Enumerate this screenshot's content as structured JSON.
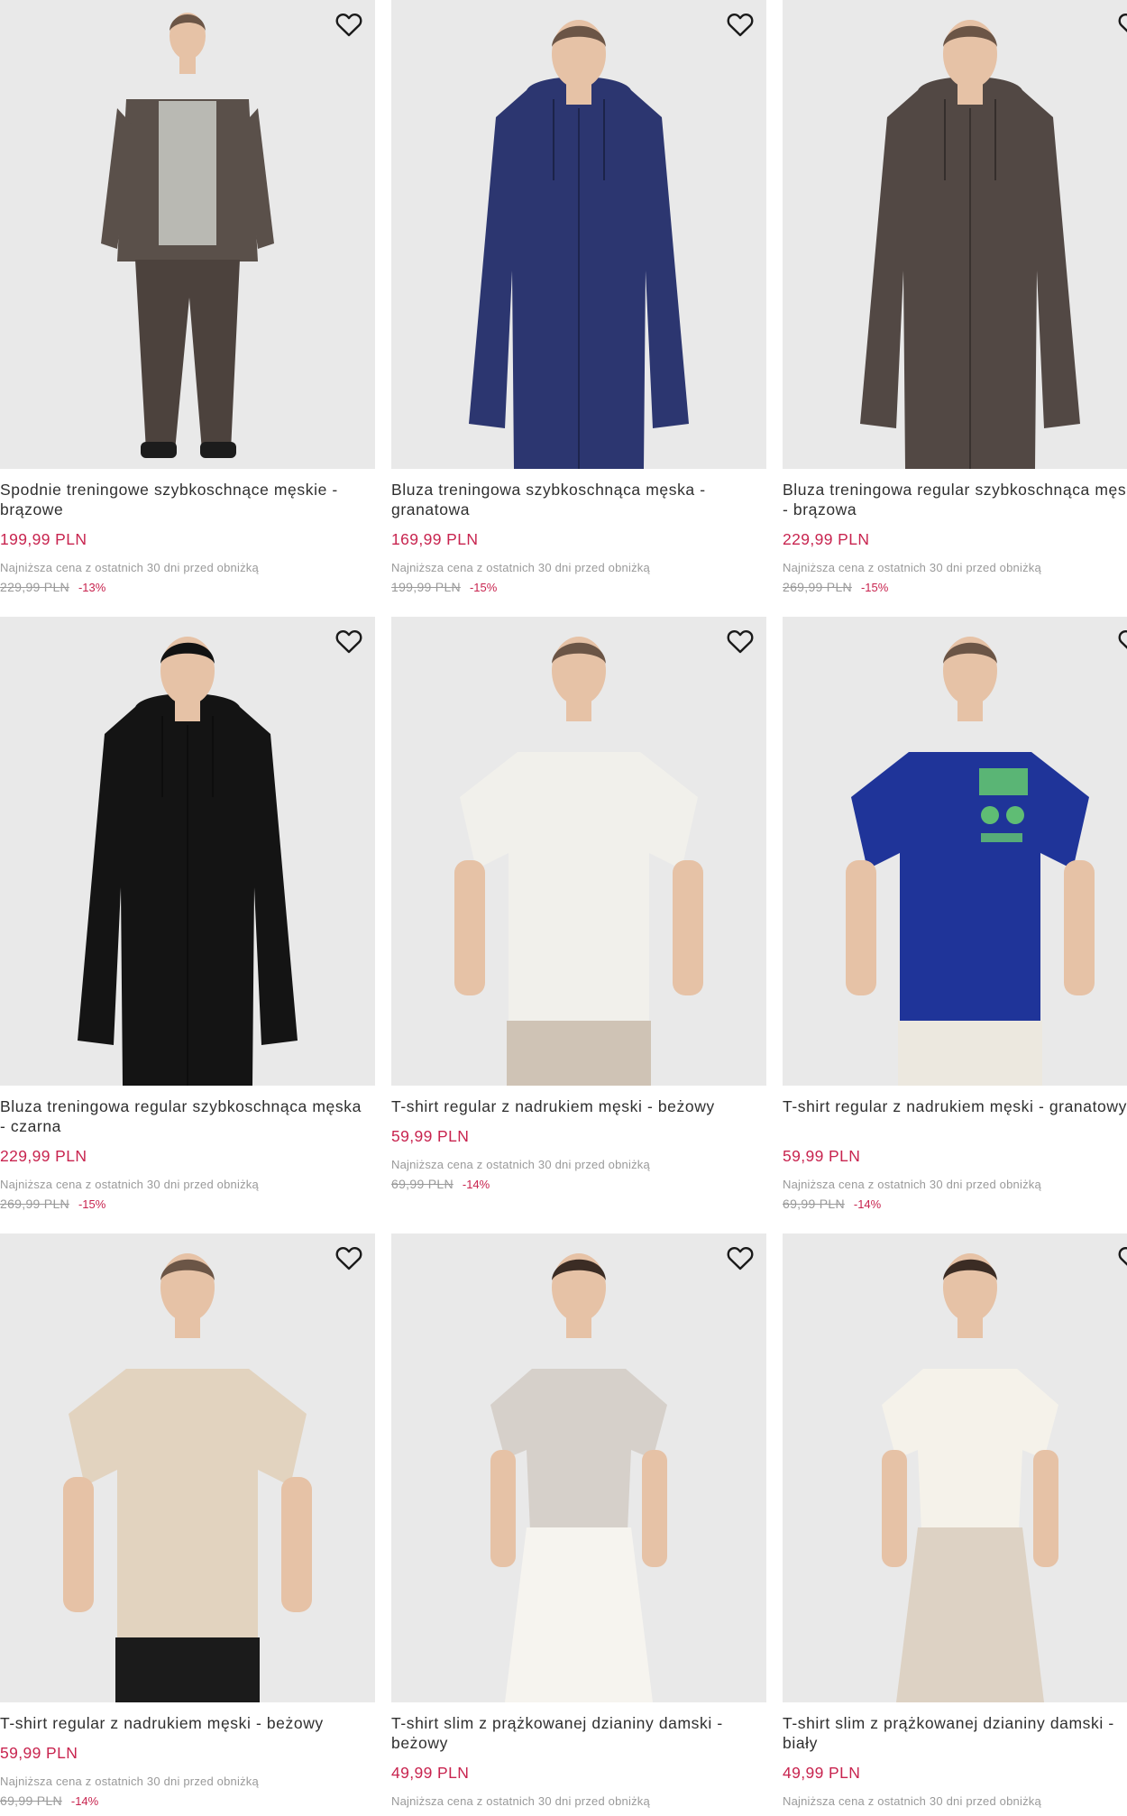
{
  "common": {
    "lowest_label": "Najniższa cena z ostatnich 30 dni przed obniżką"
  },
  "products": [
    {
      "name": "Spodnie treningowe szybkoschnące męskie - brązowe",
      "price": "199,99 PLN",
      "old_price": "229,99 PLN",
      "discount": "-13%",
      "garment": "jacket-tracksuit",
      "colors": {
        "top": "#5a504a",
        "inner": "#b9b9b3",
        "bottom": "#4c423d"
      }
    },
    {
      "name": "Bluza treningowa szybkoschnąca męska - granatowa",
      "price": "169,99 PLN",
      "old_price": "199,99 PLN",
      "discount": "-15%",
      "garment": "hoodie",
      "colors": {
        "top": "#2c3670",
        "bottom": "#2c3670"
      }
    },
    {
      "name": "Bluza treningowa regular szybkoschnąca męska - brązowa",
      "price": "229,99 PLN",
      "old_price": "269,99 PLN",
      "discount": "-15%",
      "garment": "hoodie",
      "colors": {
        "top": "#524844",
        "bottom": "#524844"
      }
    },
    {
      "name": "Bluza treningowa regular szybkoschnąca męska - czarna",
      "price": "229,99 PLN",
      "old_price": "269,99 PLN",
      "discount": "-15%",
      "garment": "hoodie",
      "colors": {
        "top": "#141414",
        "bottom": "#141414"
      }
    },
    {
      "name": "T-shirt regular z nadrukiem męski - beżowy",
      "price": "59,99 PLN",
      "old_price": "69,99 PLN",
      "discount": "-14%",
      "garment": "tshirt",
      "colors": {
        "top": "#f1f0eb",
        "bottom": "#cfc3b5"
      }
    },
    {
      "name": "T-shirt regular z nadrukiem męski - granatowy",
      "price": "59,99 PLN",
      "old_price": "69,99 PLN",
      "discount": "-14%",
      "garment": "tshirt-back",
      "colors": {
        "top": "#1f3499",
        "bottom": "#ece8df",
        "print": "#6fe06a"
      }
    },
    {
      "name": "T-shirt regular z nadrukiem męski - beżowy",
      "price": "59,99 PLN",
      "old_price": "69,99 PLN",
      "discount": "-14%",
      "garment": "tshirt",
      "colors": {
        "top": "#e2d3bf",
        "bottom": "#1b1b1b"
      }
    },
    {
      "name": "T-shirt slim z prążkowanej dzianiny damski - beżowy",
      "price": "49,99 PLN",
      "old_price": "",
      "discount": "",
      "garment": "tshirt-women",
      "colors": {
        "top": "#d6d0ca",
        "bottom": "#f6f4ef"
      }
    },
    {
      "name": "T-shirt slim z prążkowanej dzianiny damski - biały",
      "price": "49,99 PLN",
      "old_price": "",
      "discount": "",
      "garment": "tshirt-women",
      "colors": {
        "top": "#f5f2ea",
        "bottom": "#ddd2c4"
      }
    }
  ]
}
